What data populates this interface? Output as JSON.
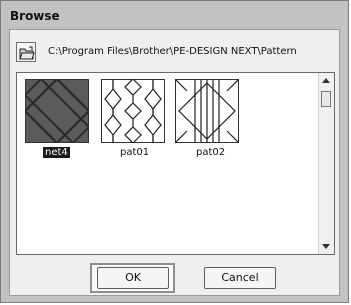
{
  "window": {
    "title": "Browse"
  },
  "path": {
    "text": "C:\\Program Files\\Brother\\PE-DESIGN NEXT\\Pattern"
  },
  "files": [
    {
      "label": "net4",
      "selected": true,
      "icon": "net-pattern-icon"
    },
    {
      "label": "pat01",
      "selected": false,
      "icon": "diamond-chain-pattern-icon"
    },
    {
      "label": "pat02",
      "selected": false,
      "icon": "diamond-stripe-pattern-icon"
    }
  ],
  "buttons": {
    "ok": "OK",
    "cancel": "Cancel"
  }
}
